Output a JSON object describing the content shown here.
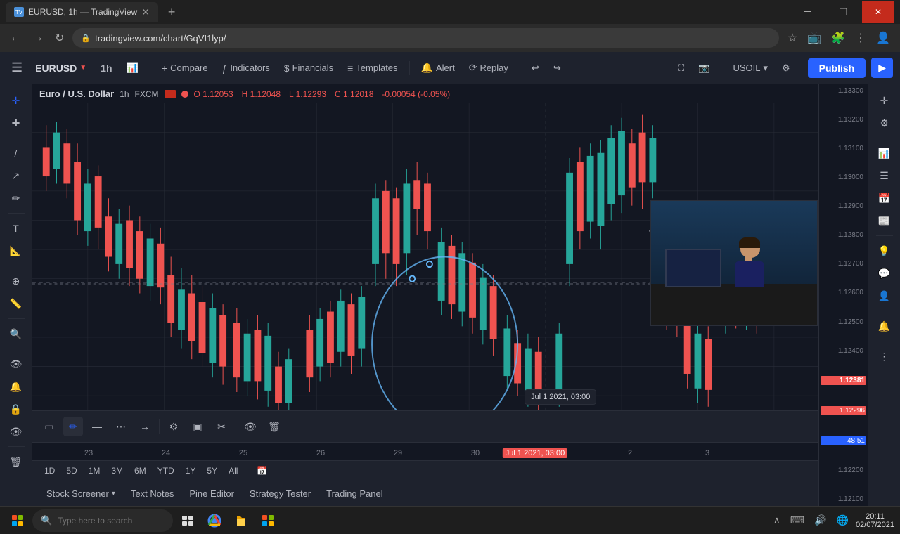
{
  "browser": {
    "tab_title": "EURUSD, 1h — TradingView",
    "favicon_text": "TV",
    "url": "tradingview.com/chart/GqVI1lyp/",
    "url_full": "tradingview.com/chart/GqVI1lyp/"
  },
  "toolbar": {
    "symbol": "EURUSD",
    "symbol_arrow": "▼",
    "timeframe_bar": "1h",
    "timeframe_icon": "⏱",
    "compare_label": "Compare",
    "indicators_label": "Indicators",
    "financials_label": "Financials",
    "templates_label": "Templates",
    "alert_label": "Alert",
    "replay_label": "Replay",
    "undo_icon": "↩",
    "redo_icon": "↪",
    "fullscreen_icon": "⛶",
    "snapshot_icon": "📷",
    "instrument": "USOIL",
    "publish_label": "Publish"
  },
  "chart_header": {
    "symbol": "Euro / U.S. Dollar",
    "interval": "1h",
    "source": "FXCM",
    "open_label": "O",
    "open_val": "1.12053",
    "high_label": "H",
    "high_val": "1.12048",
    "low_label": "L",
    "low_val": "1.12293",
    "close_label": "C",
    "close_val": "1.12018",
    "change_val": "-0.00054",
    "change_pct": "-0.05%"
  },
  "price_axis": {
    "levels": [
      "1.13300",
      "1.13200",
      "1.13100",
      "1.13000",
      "1.12900",
      "1.12800",
      "1.12700",
      "1.12600",
      "1.12500",
      "1.12400",
      "1.12381",
      "1.12296",
      "1.12200",
      "1.12100"
    ],
    "current_price": "1.12381",
    "bid_price": "1.12296",
    "small_val": "48.51"
  },
  "timeline": {
    "labels": [
      "23",
      "24",
      "25",
      "26",
      "29",
      "30",
      "Jul 1",
      "2",
      "3"
    ]
  },
  "timeframe_selector": {
    "options": [
      "1D",
      "5D",
      "1M",
      "3M",
      "6M",
      "YTD",
      "1Y",
      "5Y",
      "All"
    ],
    "extra_icon": "📅"
  },
  "bottom_tabs": {
    "tabs": [
      "Stock Screener",
      "Text Notes",
      "Pine Editor",
      "Strategy Tester",
      "Trading Panel"
    ]
  },
  "drawing_toolbar": {
    "tools": [
      "▭",
      "🖊",
      "—",
      "⋯",
      "➔",
      "⚙",
      "▭",
      "✂",
      "👁",
      "🗑"
    ]
  },
  "taskbar": {
    "search_placeholder": "Type here to search",
    "time": "20:11",
    "date": "02/07/2021",
    "tray_icons": [
      "∧",
      "⌨",
      "🔊",
      "🌐"
    ]
  },
  "tooltip": {
    "text": "Jul 1 2021, 03:00"
  },
  "webcam_visible": true,
  "colors": {
    "accent": "#2962ff",
    "bull": "#26a69a",
    "bear": "#ef5350",
    "bg": "#131722",
    "toolbar_bg": "#1e222d",
    "border": "#2a2e39",
    "text_primary": "#d1d4dc",
    "text_secondary": "#b2b5be",
    "text_muted": "#787b86",
    "drawing": "#64b5f6"
  }
}
